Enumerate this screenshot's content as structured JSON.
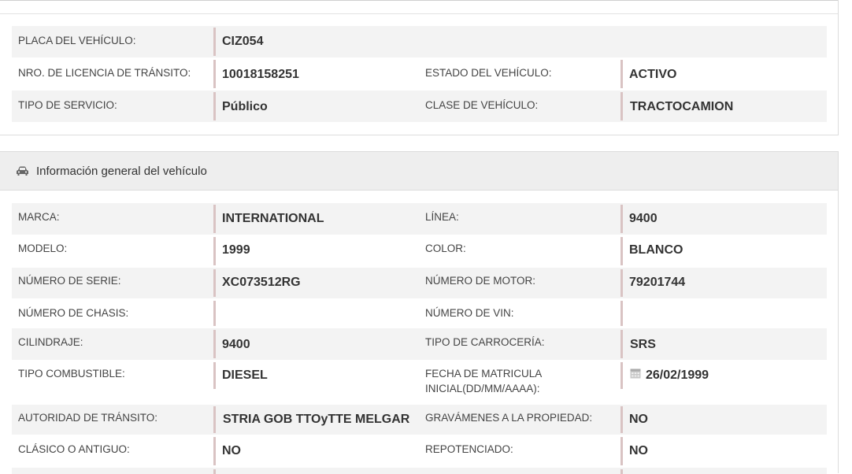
{
  "registration": {
    "plate": {
      "label": "PLACA DEL VEHÍCULO:",
      "value": "CIZ054"
    },
    "license": {
      "label": "NRO. DE LICENCIA DE TRÁNSITO:",
      "value": "10018158251"
    },
    "status": {
      "label": "ESTADO DEL VEHÍCULO:",
      "value": "ACTIVO"
    },
    "service": {
      "label": "TIPO DE SERVICIO:",
      "value": "Público"
    },
    "vehicle_class": {
      "label": "CLASE DE VEHÍCULO:",
      "value": "TRACTOCAMION"
    }
  },
  "general": {
    "title": "Información general del vehículo",
    "icon": "car-icon",
    "brand": {
      "label": "MARCA:",
      "value": "INTERNATIONAL"
    },
    "line": {
      "label": "LÍNEA:",
      "value": "9400"
    },
    "model": {
      "label": "MODELO:",
      "value": "1999"
    },
    "color": {
      "label": "COLOR:",
      "value": "BLANCO"
    },
    "serial": {
      "label": "NÚMERO DE SERIE:",
      "value": "XC073512RG"
    },
    "engine": {
      "label": "NÚMERO DE MOTOR:",
      "value": "79201744"
    },
    "chassis": {
      "label": "NÚMERO DE CHASIS:",
      "value": ""
    },
    "vin": {
      "label": "NÚMERO DE VIN:",
      "value": ""
    },
    "displacement": {
      "label": "CILINDRAJE:",
      "value": "9400"
    },
    "body_type": {
      "label": "TIPO DE CARROCERÍA:",
      "value": "SRS"
    },
    "fuel": {
      "label": "TIPO COMBUSTIBLE:",
      "value": "DIESEL"
    },
    "registration_date": {
      "label_line1": "FECHA DE MATRICULA",
      "label_line2": "INICIAL(DD/MM/AAAA):",
      "value": "26/02/1999",
      "icon": "calendar-icon"
    },
    "authority": {
      "label": "AUTORIDAD DE TRÁNSITO:",
      "value": "STRIA GOB TTOyTTE MELGAR"
    },
    "liens": {
      "label": "GRAVÁMENES A LA PROPIEDAD:",
      "value": "NO"
    },
    "classic": {
      "label": "CLÁSICO O ANTIGUO:",
      "value": "NO"
    },
    "repowered": {
      "label": "REPOTENCIADO:",
      "value": "NO"
    }
  }
}
